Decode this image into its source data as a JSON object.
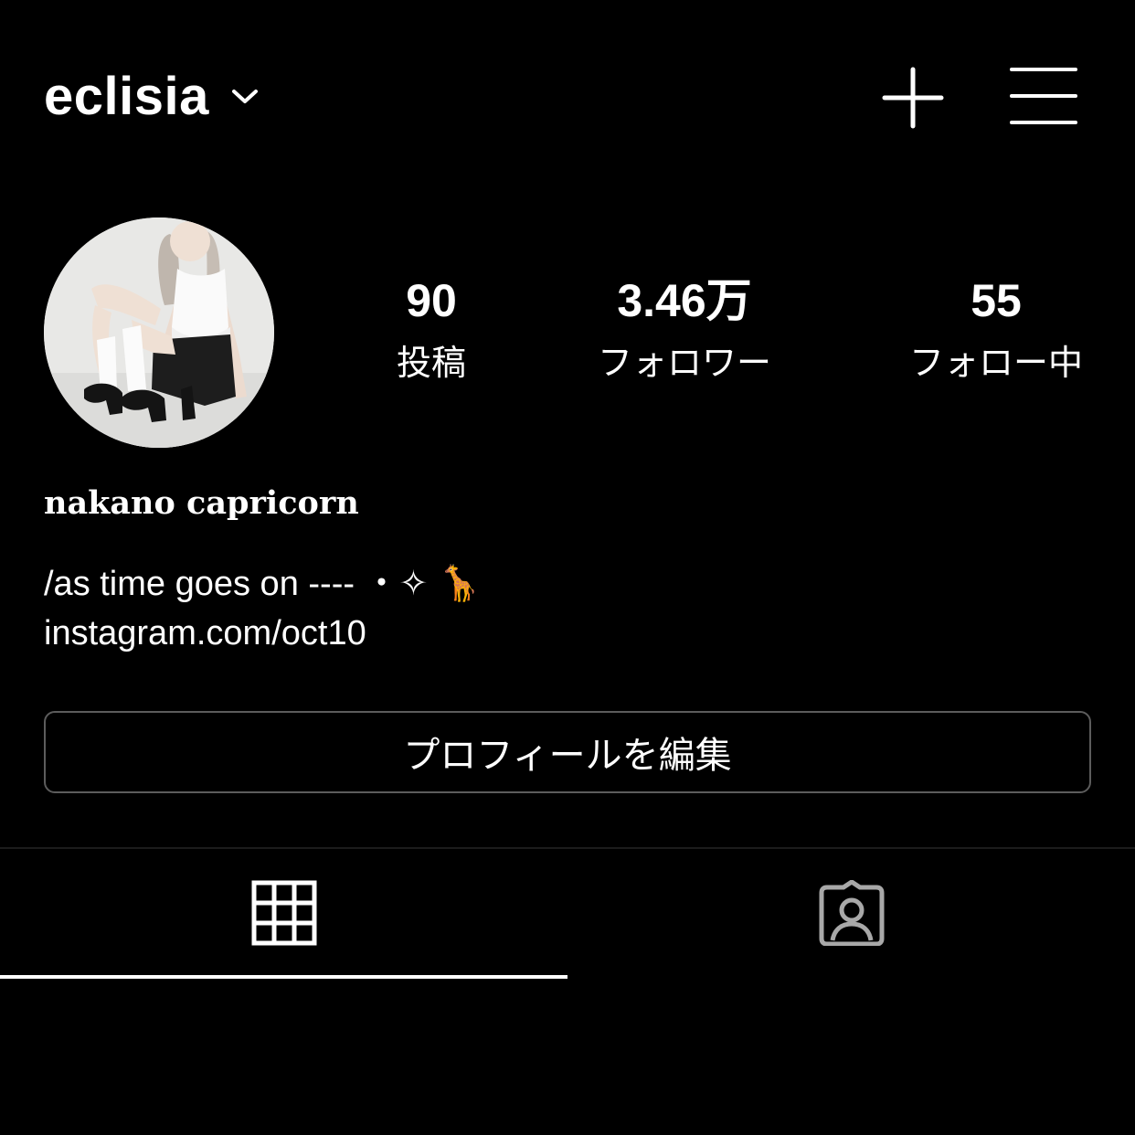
{
  "header": {
    "username": "eclisia",
    "icons": {
      "account_switch": "chevron-down-icon",
      "create": "plus-icon",
      "menu": "hamburger-menu-icon"
    }
  },
  "profile": {
    "avatar": "profile-photo",
    "stats": {
      "posts": {
        "value": "90",
        "label": "投稿"
      },
      "followers": {
        "value": "3.46万",
        "label": "フォロワー"
      },
      "following": {
        "value": "55",
        "label": "フォロー中"
      }
    },
    "display_name": "nakano capricorn",
    "bio": "/as time goes on ---- ・✧ 🦒",
    "link": "instagram.com/oct10"
  },
  "actions": {
    "edit_profile": "プロフィールを編集"
  },
  "tabs": {
    "items": [
      {
        "icon": "grid-icon",
        "active": true
      },
      {
        "icon": "tagged-person-icon",
        "active": false
      }
    ]
  },
  "colors": {
    "background": "#000000",
    "text": "#ffffff",
    "button_border": "#5c5c5c",
    "inactive_icon": "#a8a8a8"
  }
}
